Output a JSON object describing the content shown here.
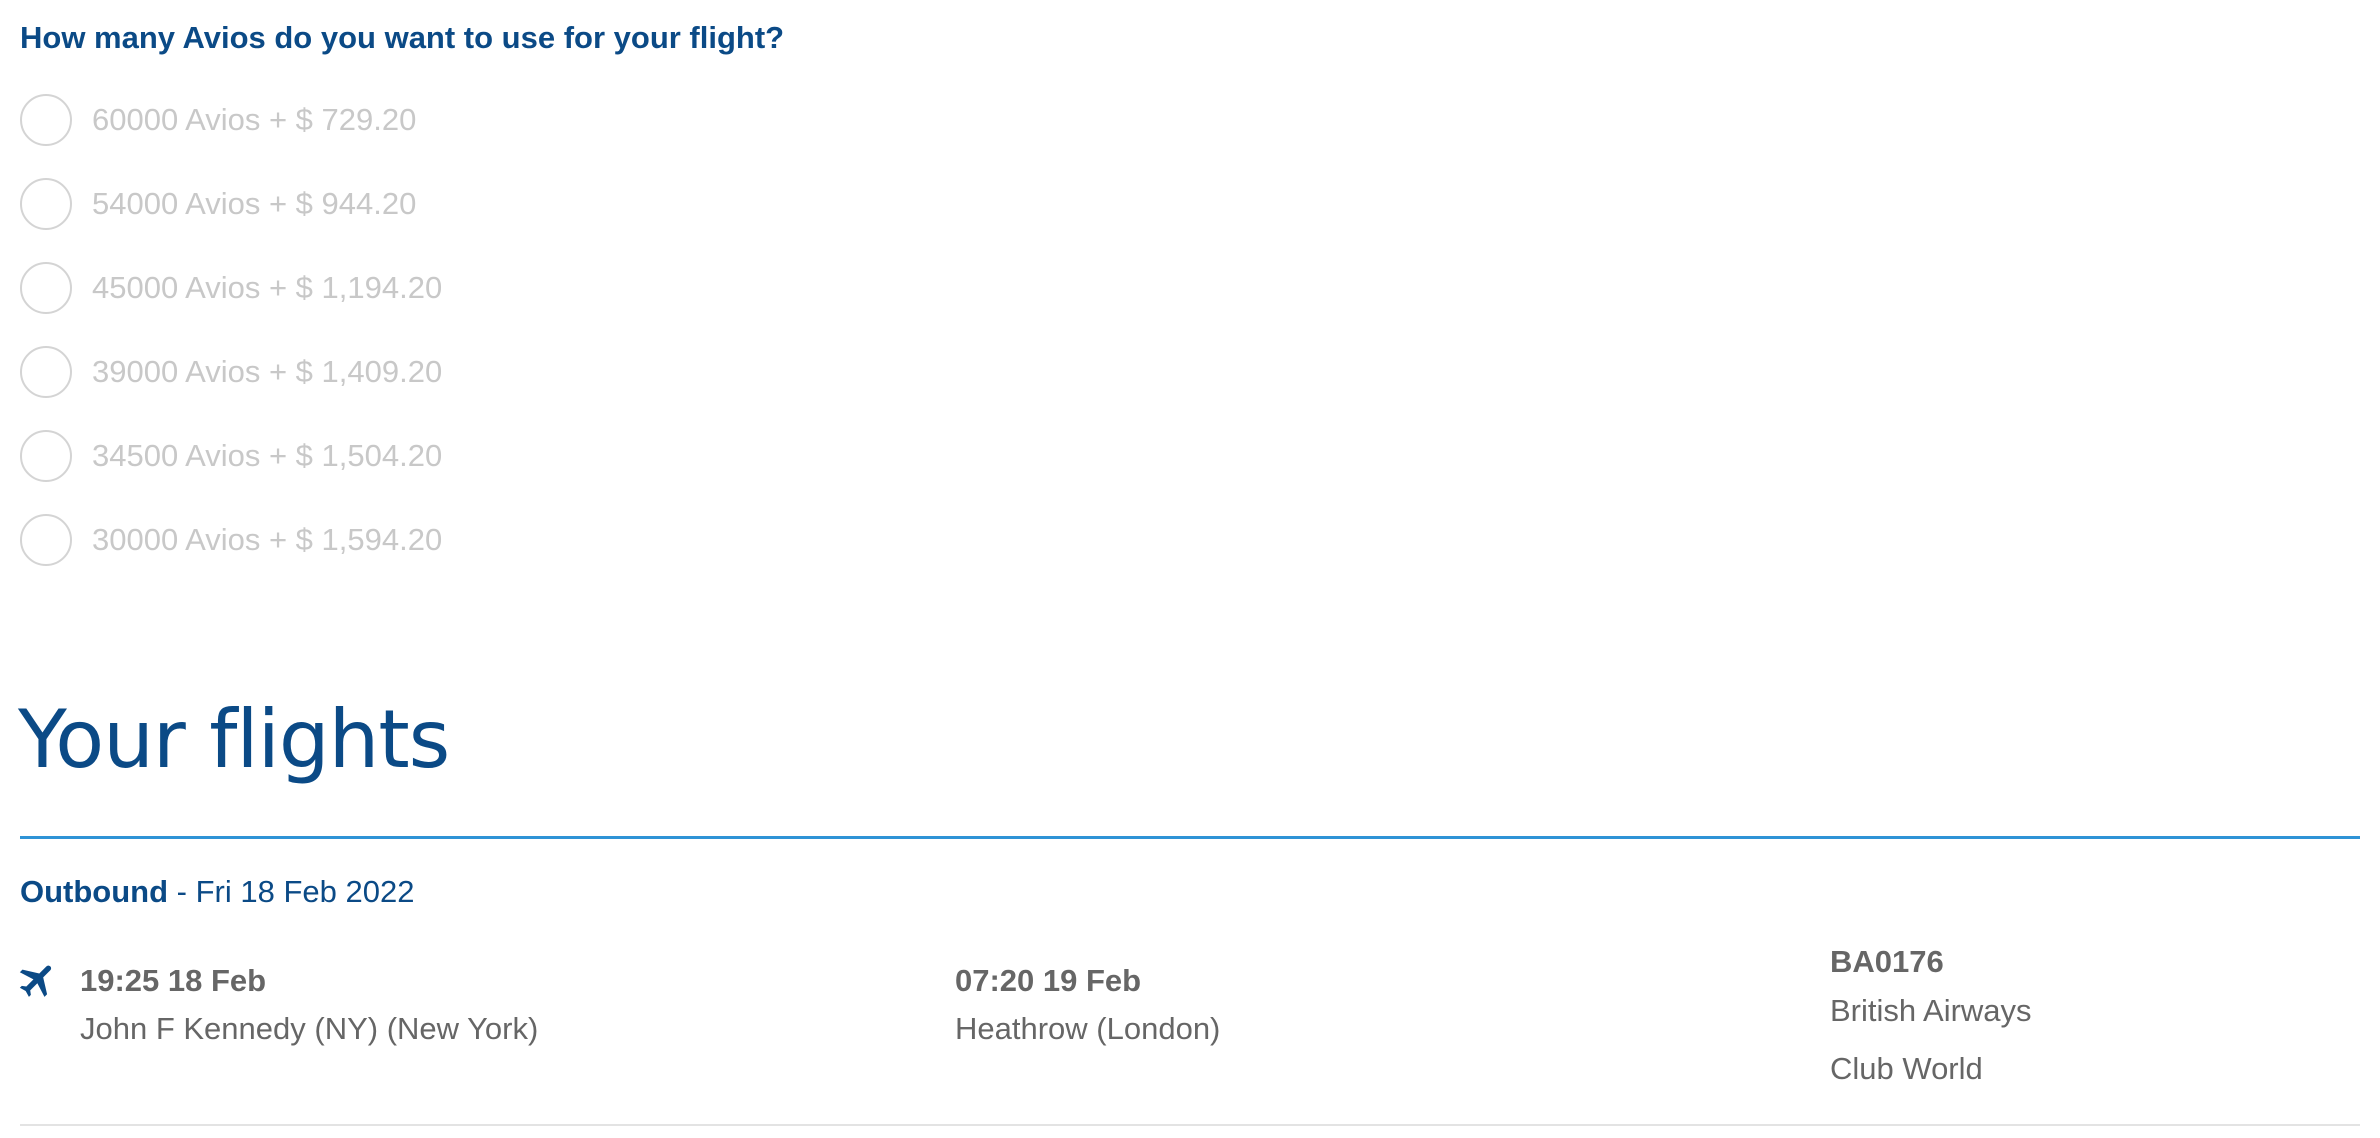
{
  "avios_question": "How many Avios do you want to use for your flight?",
  "avios_options": [
    {
      "label": "60000 Avios + $ 729.20"
    },
    {
      "label": "54000 Avios + $ 944.20"
    },
    {
      "label": "45000 Avios + $ 1,194.20"
    },
    {
      "label": "39000 Avios + $ 1,409.20"
    },
    {
      "label": "34500 Avios + $ 1,504.20"
    },
    {
      "label": "30000 Avios + $ 1,594.20"
    }
  ],
  "flights": {
    "heading": "Your flights",
    "outbound": {
      "label": "Outbound",
      "date": " - Fri 18 Feb 2022",
      "departure_time": "19:25 18 Feb",
      "departure_place": "John F Kennedy (NY) (New York)",
      "arrival_time": "07:20 19 Feb",
      "arrival_place": "Heathrow (London)",
      "flight_number": "BA0176",
      "airline": "British Airways",
      "cabin": "Club World",
      "icon": "plane-icon"
    }
  },
  "colors": {
    "brand_blue": "#0b4a86",
    "accent_blue": "#2f93d6",
    "muted_text": "#c8c8c8",
    "body_text": "#666666"
  }
}
